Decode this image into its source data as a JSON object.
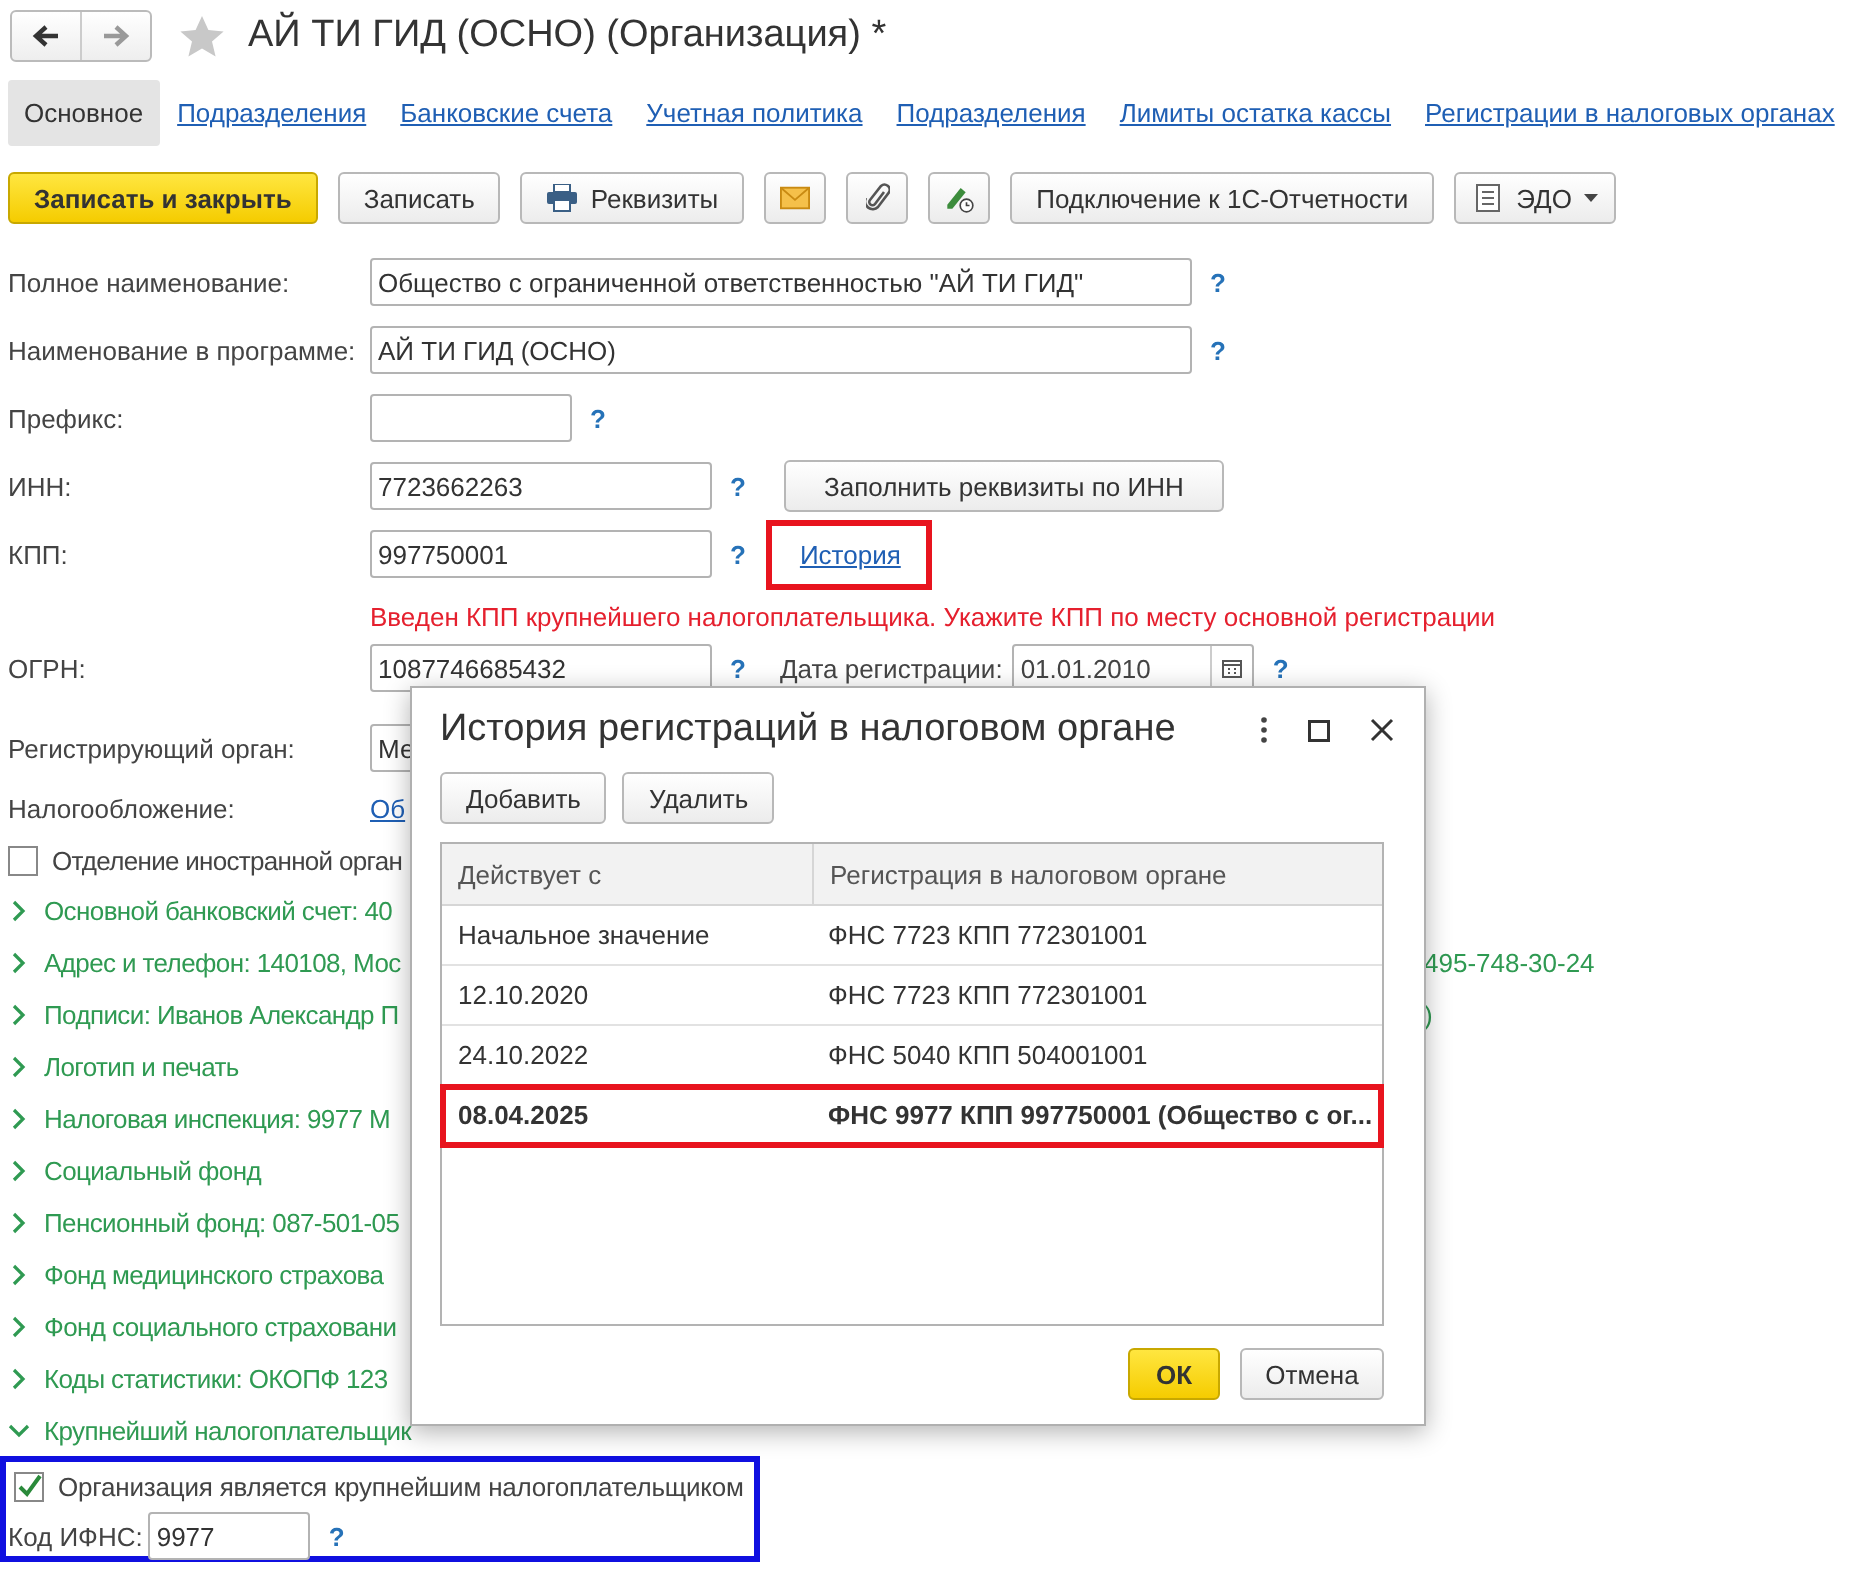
{
  "window": {
    "title": "АЙ ТИ ГИД (ОСНО) (Организация) *"
  },
  "tabs": [
    {
      "label": "Основное",
      "selected": true
    },
    {
      "label": "Подразделения",
      "selected": false
    },
    {
      "label": "Банковские счета",
      "selected": false
    },
    {
      "label": "Учетная политика",
      "selected": false
    },
    {
      "label": "Подразделения",
      "selected": false
    },
    {
      "label": "Лимиты остатка кассы",
      "selected": false
    },
    {
      "label": "Регистрации в налоговых органах",
      "selected": false
    }
  ],
  "toolbar": [
    {
      "kind": "primary",
      "label": "Записать и закрыть"
    },
    {
      "kind": "text",
      "label": "Записать"
    },
    {
      "kind": "print",
      "label": "Реквизиты"
    },
    {
      "kind": "mail"
    },
    {
      "kind": "clip"
    },
    {
      "kind": "sign"
    },
    {
      "kind": "text",
      "label": "Подключение к 1С-Отчетности"
    },
    {
      "kind": "menu",
      "label": "ЭДО"
    }
  ],
  "form": {
    "full_name": {
      "label": "Полное наименование:",
      "value": "Общество с ограниченной ответственностью \"АЙ ТИ ГИД\"",
      "help": "?"
    },
    "program_name": {
      "label": "Наименование в программе:",
      "value": "АЙ ТИ ГИД (ОСНО)",
      "help": "?"
    },
    "prefix": {
      "label": "Префикс:",
      "help": "?"
    },
    "inn": {
      "label": "ИНН:",
      "value": "7723662263",
      "help": "?",
      "button": "Заполнить реквизиты по ИНН"
    },
    "kpp": {
      "label": "КПП:",
      "value": "997750001",
      "help": "?",
      "link": {
        "label": "История",
        "highlighted": true
      },
      "warning": "Введен КПП крупнейшего налогоплательщика. Укажите КПП по месту основной регистрации"
    },
    "ogrn": {
      "label": "ОГРН:",
      "value": "1087746685432",
      "help": "?",
      "date_label": "Дата регистрации:",
      "date_value": "01.01.2010",
      "date_help": "?"
    },
    "registering_body": {
      "label": "Регистрирующий орган:",
      "value": "Ме"
    },
    "taxation": {
      "label": "Налогообложение:",
      "link": "Об"
    },
    "foreign_division": {
      "label": "Отделение иностранной орган",
      "checked": false
    }
  },
  "sections": [
    {
      "label": "Основной банковский счет: 40",
      "expanded": false
    },
    {
      "label": "Адрес и телефон: 140108, Мос",
      "tail": "495-748-30-24",
      "expanded": false
    },
    {
      "label": "Подписи: Иванов Александр П",
      "tail": ")",
      "expanded": false
    },
    {
      "label": "Логотип и печать",
      "expanded": false
    },
    {
      "label": "Налоговая инспекция: 9977 М",
      "expanded": false
    },
    {
      "label": "Социальный фонд",
      "expanded": false
    },
    {
      "label": "Пенсионный фонд: 087-501-05",
      "expanded": false
    },
    {
      "label": "Фонд медицинского страхова",
      "expanded": false
    },
    {
      "label": "Фонд социального страховани",
      "expanded": false
    },
    {
      "label": "Коды статистики: ОКОПФ 123",
      "expanded": false
    },
    {
      "label": "Крупнейший налогоплательщик",
      "expanded": true
    }
  ],
  "large_taxpayer": {
    "highlighted": true,
    "checkbox": {
      "label": "Организация является крупнейшим налогоплательщиком",
      "checked": true
    },
    "ifns": {
      "label": "Код ИФНС:",
      "value": "9977",
      "help": "?"
    }
  },
  "dialog": {
    "title": "История регистраций в налоговом органе",
    "buttons": [
      "Добавить",
      "Удалить"
    ],
    "columns": [
      "Действует с",
      "Регистрация в налоговом органе"
    ],
    "rows": [
      {
        "cells": [
          "Начальное значение",
          "ФНС 7723 КПП 772301001"
        ],
        "selected": false,
        "highlighted": false
      },
      {
        "cells": [
          "12.10.2020",
          "ФНС 7723 КПП 772301001"
        ],
        "selected": false,
        "highlighted": false
      },
      {
        "cells": [
          "24.10.2022",
          "ФНС 5040 КПП 504001001"
        ],
        "selected": false,
        "highlighted": false
      },
      {
        "cells": [
          "08.04.2025",
          "ФНС 9977 КПП 997750001 (Общество с ог..."
        ],
        "selected": true,
        "highlighted": true
      }
    ],
    "footer": [
      {
        "kind": "default",
        "label": "ОК"
      },
      {
        "kind": "normal",
        "label": "Отмена"
      }
    ]
  }
}
